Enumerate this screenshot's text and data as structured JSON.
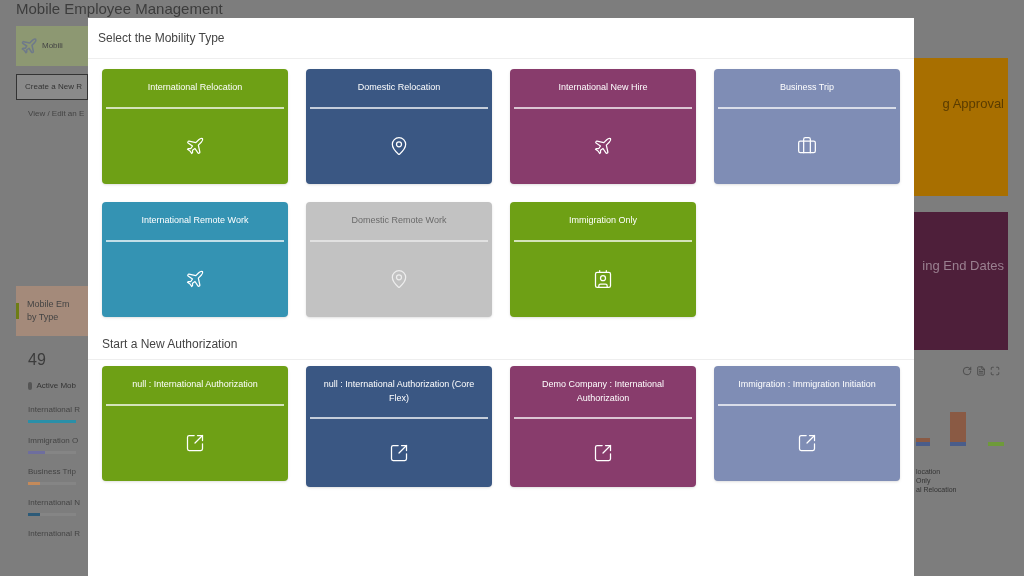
{
  "page": {
    "title": "Mobile Employee Management",
    "left_panel": {
      "tile_label": "Mobili",
      "create_button": "Create a New R",
      "view_link": "View / Edit an E"
    },
    "summary": {
      "title": "Mobile Em",
      "subtitle": "by Type",
      "count": "49",
      "count_label": "Active Mob",
      "types": [
        {
          "label": "International R",
          "color": "#2a8fa8",
          "level": 1
        },
        {
          "label": "Immigration O",
          "color": "#6e6e9e",
          "level": 0.35
        },
        {
          "label": "Business Trip",
          "color": "#c48a5a",
          "level": 0.25
        },
        {
          "label": "International N",
          "color": "#2c5a78",
          "level": 0.25
        },
        {
          "label": "International R"
        }
      ]
    },
    "right_panel": {
      "pending_approval": "g Approval",
      "end_dates": "ing End Dates",
      "legend": [
        "location",
        "Only",
        "al Relocation"
      ]
    }
  },
  "modal": {
    "title": "Select the Mobility Type",
    "mobility_types": [
      {
        "label": "International Relocation",
        "color": "#6ea015",
        "kind": "plane",
        "disabled": false
      },
      {
        "label": "Domestic Relocation",
        "color": "#3a5783",
        "kind": "pin",
        "disabled": false
      },
      {
        "label": "International New Hire",
        "color": "#883c6c",
        "kind": "plane",
        "disabled": false
      },
      {
        "label": "Business Trip",
        "color": "#7f8db5",
        "kind": "briefcase",
        "disabled": false
      },
      {
        "label": "International Remote Work",
        "color": "#3493b3",
        "kind": "plane",
        "disabled": false
      },
      {
        "label": "Domestic Remote Work",
        "color": "#c2c2c2",
        "kind": "pin",
        "disabled": true
      },
      {
        "label": "Immigration Only",
        "color": "#6ea015",
        "kind": "badge",
        "disabled": false
      }
    ],
    "auth_title": "Start a New Authorization",
    "authorizations": [
      {
        "label": "null : International Authorization",
        "color": "#6ea015"
      },
      {
        "label": "null : International Authorization (Core Flex)",
        "color": "#3a5783"
      },
      {
        "label": "Demo Company : International Authorization",
        "color": "#883c6c"
      },
      {
        "label": "Immigration : Immigration Initiation",
        "color": "#7f8db5"
      }
    ]
  }
}
